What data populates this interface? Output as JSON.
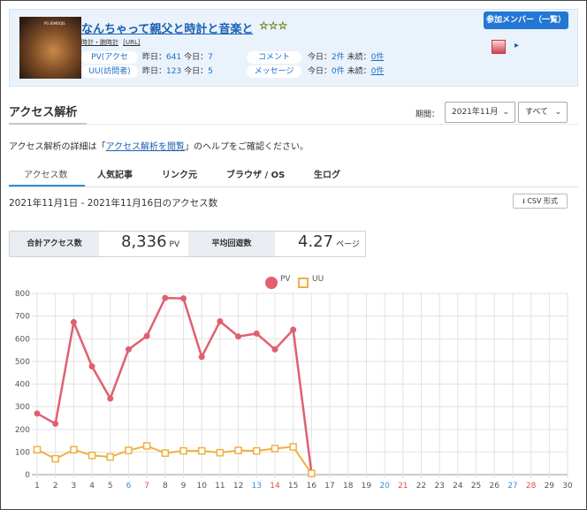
{
  "header": {
    "thumb_caption": "PG BIMBOJS",
    "title": "なんちゃって親父と時計と音楽と",
    "stars": "☆☆☆",
    "sublink_blog": "時計・腕時計",
    "sublink_url": "[URL]",
    "pv_label": "PV(アクセス)",
    "pv_stats": {
      "prefix": "昨日：",
      "yesterday": "641",
      "mid": " 今日：",
      "today": "7"
    },
    "uu_label": "UU(訪問者)",
    "uu_stats": {
      "prefix": "昨日：",
      "yesterday": "123",
      "mid": " 今日：",
      "today": "5"
    },
    "comment_label": "コメント",
    "comment_stats": {
      "prefix": "今日：",
      "today": "2件",
      "mid": " 未読：",
      "unread": "0件"
    },
    "message_label": "メッセージ",
    "message_stats": {
      "prefix": "今日：",
      "today": "0件",
      "mid": " 未読：",
      "unread": "0件"
    },
    "member_button": "参加メンバー（一覧）"
  },
  "section": {
    "title": "アクセス解析",
    "period_label": "期間：",
    "period_value": "2021年11月",
    "filter_value": "すべて"
  },
  "help": {
    "before": "アクセス解析の詳細は「",
    "link": "アクセス解析を閲覧",
    "after": "」のヘルプをご確認ください。"
  },
  "tabs": [
    "アクセス数",
    "人気記事",
    "リンク元",
    "ブラウザ / OS",
    "生ログ"
  ],
  "range_text": "2021年11月1日 - 2021年11月16日のアクセス数",
  "csv_button": "CSV 形式",
  "totals": {
    "total_label": "合計アクセス数",
    "total_value": "8,336",
    "total_unit": "PV",
    "avg_label": "平均回遊数",
    "avg_value": "4.27",
    "avg_unit": "ページ"
  },
  "colors": {
    "pv": "#e06070",
    "uu": "#f0b040",
    "accent": "#2477d4",
    "sunday": "#e05050",
    "saturday": "#3a8ee0"
  },
  "chart_data": {
    "type": "line",
    "x": [
      1,
      2,
      3,
      4,
      5,
      6,
      7,
      8,
      9,
      10,
      11,
      12,
      13,
      14,
      15,
      16,
      17,
      18,
      19,
      20,
      21,
      22,
      23,
      24,
      25,
      26,
      27,
      28,
      29,
      30
    ],
    "ylim": [
      0,
      800
    ],
    "yticks": [
      0,
      100,
      200,
      300,
      400,
      500,
      600,
      700,
      800
    ],
    "saturdays": [
      6,
      13,
      20,
      27
    ],
    "sundays": [
      7,
      14,
      21,
      28
    ],
    "grid": true,
    "legend_position": "top-center",
    "series": [
      {
        "name": "PV",
        "values": [
          270,
          225,
          673,
          478,
          336,
          553,
          612,
          780,
          778,
          520,
          677,
          610,
          623,
          553,
          640,
          7
        ]
      },
      {
        "name": "UU",
        "values": [
          110,
          70,
          110,
          85,
          78,
          107,
          127,
          95,
          105,
          105,
          97,
          107,
          105,
          115,
          123,
          5
        ]
      }
    ]
  }
}
